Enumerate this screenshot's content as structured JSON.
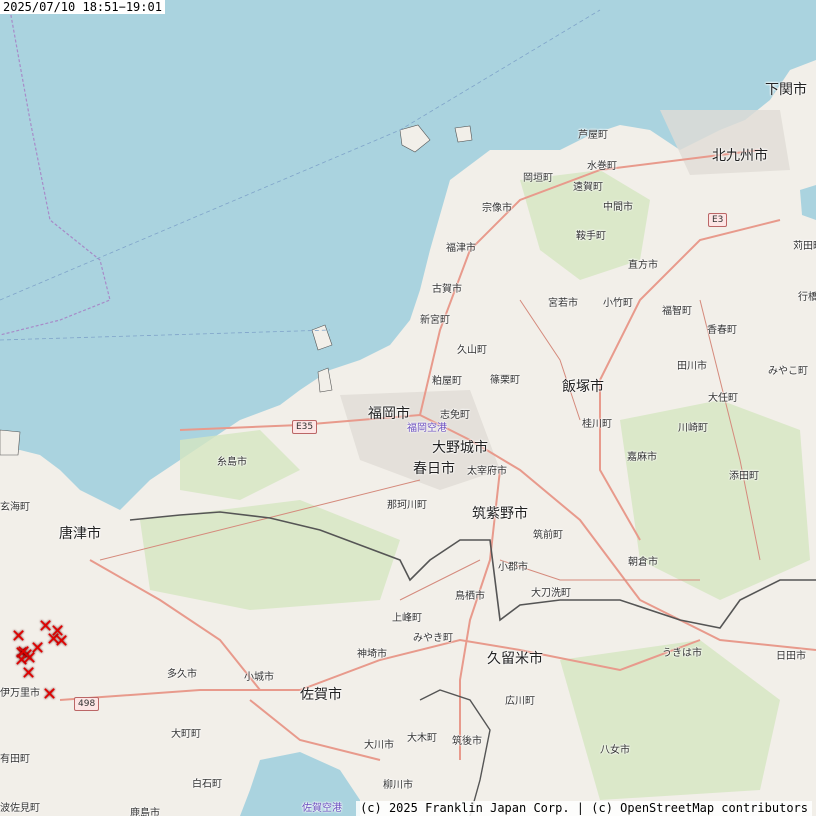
{
  "timestamp": "2025/07/10 18:51−19:01",
  "attribution": "(c) 2025 Franklin Japan Corp. | (c) OpenStreetMap contributors",
  "colors": {
    "sea": "#aad3df",
    "land": "#f2efe9",
    "forest": "#c8dfb0",
    "road": "#e89a8c",
    "boundary": "#555555",
    "marker": "#e00000"
  },
  "road_shields": {
    "e35": "E35",
    "e3": "E3",
    "r498": "498"
  },
  "places": {
    "fukuoka": "福岡市",
    "kitakyushu": "北九州市",
    "shimonoseki": "下関市",
    "iizuka": "飯塚市",
    "kurume": "久留米市",
    "saga": "佐賀市",
    "karatsu": "唐津市",
    "kasuga": "春日市",
    "onojo": "大野城市",
    "chikushino": "筑紫野市",
    "ashiya": "芦屋町",
    "okagaki": "岡垣町",
    "onga": "遠賀町",
    "mizumaki": "水巻町",
    "munakata": "宗像市",
    "nakama": "中間市",
    "kurate": "鞍手町",
    "fukutsu": "福津市",
    "koga": "古賀市",
    "miyawaka": "宮若市",
    "kotake": "小竹町",
    "nogata": "直方市",
    "shingu": "新宮町",
    "hisayama": "久山町",
    "sasaguri": "篠栗町",
    "kasuya": "粕屋町",
    "shime": "志免町",
    "fukuoka_airport": "福岡空港",
    "fukuchi": "福智町",
    "kawara": "香春町",
    "tagawa": "田川市",
    "miyako": "みやこ町",
    "otou": "大任町",
    "kawasaki": "川崎町",
    "keisen": "桂川町",
    "kama": "嘉麻市",
    "soeda": "添田町",
    "dazaifu": "太宰府市",
    "nakagawa": "那珂川町",
    "itoshima": "糸島市",
    "chikuzen": "筑前町",
    "asakura": "朝倉市",
    "ogori": "小郡市",
    "tachiarai": "大刀洗町",
    "tosu": "鳥栖市",
    "kamimine": "上峰町",
    "miyaki": "みやき町",
    "kanzaki": "神埼市",
    "ukiha": "うきは市",
    "hita": "日田市",
    "hirokawa": "広川町",
    "yame": "八女市",
    "chikugo": "筑後市",
    "okawa": "大川市",
    "oki": "大木町",
    "yanagawa": "柳川市",
    "saga_airport": "佐賀空港",
    "ogi": "小城市",
    "taku": "多久市",
    "imari": "伊万里市",
    "omachi": "大町町",
    "shiroishi": "白石町",
    "kashima": "鹿島市",
    "hasami": "波佐見町",
    "arita": "有田町",
    "genkai": "玄海町",
    "kanda": "苅田町",
    "yukuhashi": "行橋市"
  },
  "markers": {
    "symbol": "✕",
    "count": 13
  }
}
